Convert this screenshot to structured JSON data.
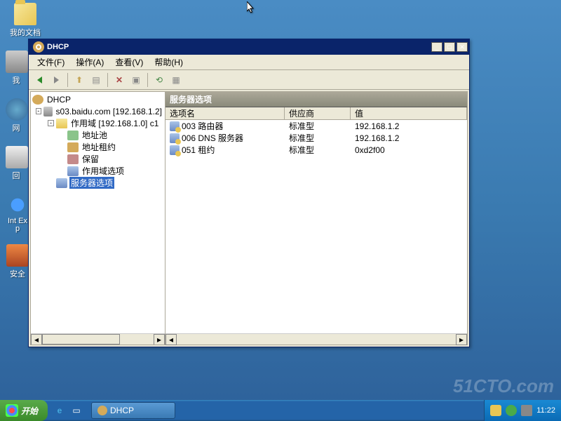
{
  "desktop": {
    "icons": [
      "我的文档",
      "我",
      "网",
      "回",
      "Int Exp",
      "安全"
    ]
  },
  "window": {
    "title": "DHCP",
    "menu": {
      "file": "文件(F)",
      "action": "操作(A)",
      "view": "查看(V)",
      "help": "帮助(H)"
    },
    "tree": {
      "root": "DHCP",
      "server": "s03.baidu.com [192.168.1.2]",
      "scope": "作用域 [192.168.1.0] c1",
      "nodes": {
        "pool": "地址池",
        "lease": "地址租约",
        "res": "保留",
        "scopeopt": "作用域选项",
        "srvopt": "服务器选项"
      }
    },
    "right": {
      "header": "服务器选项",
      "cols": {
        "name": "选项名",
        "vendor": "供应商",
        "value": "值"
      },
      "rows": [
        {
          "name": "003 路由器",
          "vendor": "标准型",
          "value": "192.168.1.2"
        },
        {
          "name": "006 DNS 服务器",
          "vendor": "标准型",
          "value": "192.168.1.2"
        },
        {
          "name": "051 租约",
          "vendor": "标准型",
          "value": "0xd2f00"
        }
      ]
    }
  },
  "taskbar": {
    "start": "开始",
    "task": "DHCP",
    "clock": "11:22"
  },
  "watermark": "51CTO.com"
}
